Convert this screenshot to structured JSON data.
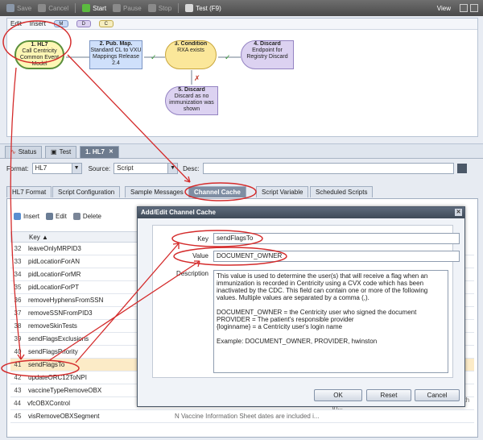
{
  "toolbar": {
    "save": "Save",
    "cancel": "Cancel",
    "start": "Start",
    "pause": "Pause",
    "stop": "Stop",
    "test": "Test (F9)",
    "view": "View"
  },
  "editor": {
    "menu_edit": "Edit",
    "menu_insert": "Insert",
    "chips": [
      "M",
      "D",
      "C"
    ],
    "nodes": {
      "n1_title": "1. HL7",
      "n1_text": "Call Centricity Common Event Model",
      "n2_title": "2. Pub. Map.",
      "n2_text": "Standard CL to VXU Mappings Release 2.4",
      "n3_title": "3. Condition",
      "n3_text": "RXA exists",
      "n4_title": "4. Discard",
      "n4_text": "Endpoint for Registry Discard",
      "n5_title": "5. Discard",
      "n5_text": "Discard as no immunization was shown"
    }
  },
  "tabs": [
    "Status",
    "Test",
    "1. HL7"
  ],
  "panel": {
    "format_label": "Format:",
    "format_value": "HL7",
    "source_label": "Source:",
    "source_value": "Script",
    "desc_label": "Desc:",
    "sub_tabs": [
      "HL7 Format",
      "Script Configuration",
      "Sample Messages",
      "Channel Cache",
      "Script Variable",
      "Scheduled Scripts"
    ],
    "insert": "Insert",
    "edit": "Edit",
    "delete": "Delete",
    "key_header": "Key"
  },
  "rows": [
    {
      "num": "32",
      "key": "leaveOnlyMRPID3"
    },
    {
      "num": "33",
      "key": "pidLocationForAN"
    },
    {
      "num": "34",
      "key": "pidLocationForMR"
    },
    {
      "num": "35",
      "key": "pidLocationForPT"
    },
    {
      "num": "36",
      "key": "removeHyphensFromSSN"
    },
    {
      "num": "37",
      "key": "removeSSNFromPID3"
    },
    {
      "num": "38",
      "key": "removeSkinTests"
    },
    {
      "num": "39",
      "key": "sendFlagsExclusions"
    },
    {
      "num": "40",
      "key": "sendFlagsPriority"
    },
    {
      "num": "41",
      "key": "sendFlagsTo"
    },
    {
      "num": "42",
      "key": "updateORC12ToNPI"
    },
    {
      "num": "43",
      "key": "vaccineTypeRemoveOBX"
    },
    {
      "num": "44",
      "key": "vfcOBXControl"
    },
    {
      "num": "45",
      "key": "visRemoveOBXSegment"
    }
  ],
  "behind_text": {
    "r44": "If include = a OBX segment will be included with th...",
    "r45": "N    Vaccine Information Sheet dates are included i..."
  },
  "dialog": {
    "title": "Add/Edit Channel Cache",
    "key_label": "Key",
    "key_value": "sendFlagsTo",
    "value_label": "Value",
    "value_value": "DOCUMENT_OWNER",
    "desc_label": "Description",
    "desc_p1": "This value is used to determine the user(s) that will receive a flag when an immunization is recorded in Centricity using a CVX code which has been inactivated by the CDC. This field can contain one or more of the following values. Multiple values are separated by a comma (,).",
    "desc_p2": "DOCUMENT_OWNER = the Centricity user who signed the document\nPROVIDER = The patient's responsible provider\n{loginname} = a Centricity user's login name",
    "desc_p3": "Example: DOCUMENT_OWNER, PROVIDER, hwinston",
    "ok": "OK",
    "reset": "Reset",
    "cancel": "Cancel"
  }
}
